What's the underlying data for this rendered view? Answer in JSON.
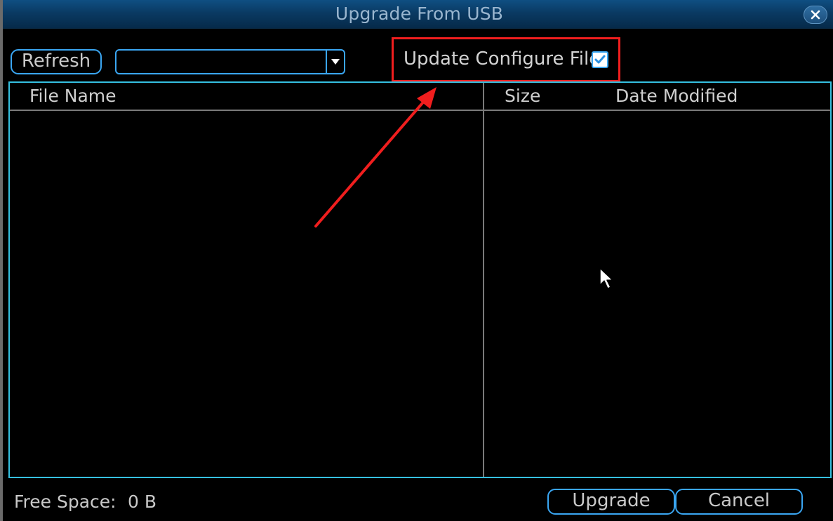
{
  "window": {
    "title": "Upgrade From USB",
    "close_icon": "close-icon"
  },
  "toolbar": {
    "refresh_label": "Refresh",
    "device_select_value": "",
    "update_config_label": "Update Configure File",
    "update_config_checked": true
  },
  "table": {
    "columns": [
      "File Name",
      "Size",
      "Date Modified"
    ],
    "rows": []
  },
  "footer": {
    "free_space_label": "Free Space:",
    "free_space_value": "0 B",
    "upgrade_label": "Upgrade",
    "cancel_label": "Cancel"
  },
  "colors": {
    "accent": "#3aa6f2",
    "table_border": "#35c0e0",
    "annotation": "#f01e1e",
    "titlebar": "#0a3a63"
  }
}
